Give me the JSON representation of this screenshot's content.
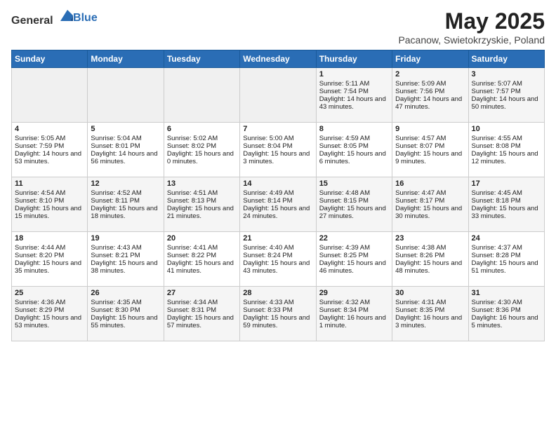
{
  "header": {
    "logo_general": "General",
    "logo_blue": "Blue",
    "title": "May 2025",
    "location": "Pacanow, Swietokrzyskie, Poland"
  },
  "days_of_week": [
    "Sunday",
    "Monday",
    "Tuesday",
    "Wednesday",
    "Thursday",
    "Friday",
    "Saturday"
  ],
  "weeks": [
    [
      {
        "day": "",
        "info": ""
      },
      {
        "day": "",
        "info": ""
      },
      {
        "day": "",
        "info": ""
      },
      {
        "day": "",
        "info": ""
      },
      {
        "day": "1",
        "info": "Sunrise: 5:11 AM\nSunset: 7:54 PM\nDaylight: 14 hours and 43 minutes."
      },
      {
        "day": "2",
        "info": "Sunrise: 5:09 AM\nSunset: 7:56 PM\nDaylight: 14 hours and 47 minutes."
      },
      {
        "day": "3",
        "info": "Sunrise: 5:07 AM\nSunset: 7:57 PM\nDaylight: 14 hours and 50 minutes."
      }
    ],
    [
      {
        "day": "4",
        "info": "Sunrise: 5:05 AM\nSunset: 7:59 PM\nDaylight: 14 hours and 53 minutes."
      },
      {
        "day": "5",
        "info": "Sunrise: 5:04 AM\nSunset: 8:01 PM\nDaylight: 14 hours and 56 minutes."
      },
      {
        "day": "6",
        "info": "Sunrise: 5:02 AM\nSunset: 8:02 PM\nDaylight: 15 hours and 0 minutes."
      },
      {
        "day": "7",
        "info": "Sunrise: 5:00 AM\nSunset: 8:04 PM\nDaylight: 15 hours and 3 minutes."
      },
      {
        "day": "8",
        "info": "Sunrise: 4:59 AM\nSunset: 8:05 PM\nDaylight: 15 hours and 6 minutes."
      },
      {
        "day": "9",
        "info": "Sunrise: 4:57 AM\nSunset: 8:07 PM\nDaylight: 15 hours and 9 minutes."
      },
      {
        "day": "10",
        "info": "Sunrise: 4:55 AM\nSunset: 8:08 PM\nDaylight: 15 hours and 12 minutes."
      }
    ],
    [
      {
        "day": "11",
        "info": "Sunrise: 4:54 AM\nSunset: 8:10 PM\nDaylight: 15 hours and 15 minutes."
      },
      {
        "day": "12",
        "info": "Sunrise: 4:52 AM\nSunset: 8:11 PM\nDaylight: 15 hours and 18 minutes."
      },
      {
        "day": "13",
        "info": "Sunrise: 4:51 AM\nSunset: 8:13 PM\nDaylight: 15 hours and 21 minutes."
      },
      {
        "day": "14",
        "info": "Sunrise: 4:49 AM\nSunset: 8:14 PM\nDaylight: 15 hours and 24 minutes."
      },
      {
        "day": "15",
        "info": "Sunrise: 4:48 AM\nSunset: 8:15 PM\nDaylight: 15 hours and 27 minutes."
      },
      {
        "day": "16",
        "info": "Sunrise: 4:47 AM\nSunset: 8:17 PM\nDaylight: 15 hours and 30 minutes."
      },
      {
        "day": "17",
        "info": "Sunrise: 4:45 AM\nSunset: 8:18 PM\nDaylight: 15 hours and 33 minutes."
      }
    ],
    [
      {
        "day": "18",
        "info": "Sunrise: 4:44 AM\nSunset: 8:20 PM\nDaylight: 15 hours and 35 minutes."
      },
      {
        "day": "19",
        "info": "Sunrise: 4:43 AM\nSunset: 8:21 PM\nDaylight: 15 hours and 38 minutes."
      },
      {
        "day": "20",
        "info": "Sunrise: 4:41 AM\nSunset: 8:22 PM\nDaylight: 15 hours and 41 minutes."
      },
      {
        "day": "21",
        "info": "Sunrise: 4:40 AM\nSunset: 8:24 PM\nDaylight: 15 hours and 43 minutes."
      },
      {
        "day": "22",
        "info": "Sunrise: 4:39 AM\nSunset: 8:25 PM\nDaylight: 15 hours and 46 minutes."
      },
      {
        "day": "23",
        "info": "Sunrise: 4:38 AM\nSunset: 8:26 PM\nDaylight: 15 hours and 48 minutes."
      },
      {
        "day": "24",
        "info": "Sunrise: 4:37 AM\nSunset: 8:28 PM\nDaylight: 15 hours and 51 minutes."
      }
    ],
    [
      {
        "day": "25",
        "info": "Sunrise: 4:36 AM\nSunset: 8:29 PM\nDaylight: 15 hours and 53 minutes."
      },
      {
        "day": "26",
        "info": "Sunrise: 4:35 AM\nSunset: 8:30 PM\nDaylight: 15 hours and 55 minutes."
      },
      {
        "day": "27",
        "info": "Sunrise: 4:34 AM\nSunset: 8:31 PM\nDaylight: 15 hours and 57 minutes."
      },
      {
        "day": "28",
        "info": "Sunrise: 4:33 AM\nSunset: 8:33 PM\nDaylight: 15 hours and 59 minutes."
      },
      {
        "day": "29",
        "info": "Sunrise: 4:32 AM\nSunset: 8:34 PM\nDaylight: 16 hours and 1 minute."
      },
      {
        "day": "30",
        "info": "Sunrise: 4:31 AM\nSunset: 8:35 PM\nDaylight: 16 hours and 3 minutes."
      },
      {
        "day": "31",
        "info": "Sunrise: 4:30 AM\nSunset: 8:36 PM\nDaylight: 16 hours and 5 minutes."
      }
    ]
  ]
}
